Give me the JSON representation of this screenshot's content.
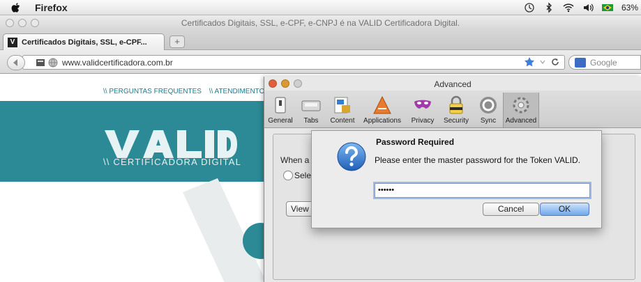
{
  "menubar": {
    "app_name": "Firefox",
    "battery_percent": "63%"
  },
  "browser": {
    "window_title": "Certificados Digitais, SSL, e-CPF, e-CNPJ é na VALID Certificadora Digital.",
    "tab_title": "Certificados Digitais, SSL, e-CPF...",
    "new_tab_symbol": "+",
    "url": "www.validcertificadora.com.br",
    "search_placeholder": "Google"
  },
  "page": {
    "topnav_links": [
      "\\\\ PERGUNTAS FREQUENTES",
      "\\\\ ATENDIMENTO"
    ],
    "brand_name": "VALID",
    "brand_subtitle": "\\\\ CERTIFICADORA DIGITAL",
    "accent_color": "#2b8a96"
  },
  "preferences": {
    "title": "Advanced",
    "tabs": [
      {
        "label": "General",
        "icon": "switch-icon"
      },
      {
        "label": "Tabs",
        "icon": "tabs-icon"
      },
      {
        "label": "Content",
        "icon": "content-icon"
      },
      {
        "label": "Applications",
        "icon": "applications-icon"
      },
      {
        "label": "Privacy",
        "icon": "mask-icon"
      },
      {
        "label": "Security",
        "icon": "padlock-icon"
      },
      {
        "label": "Sync",
        "icon": "sync-icon"
      },
      {
        "label": "Advanced",
        "icon": "gear-icon"
      }
    ],
    "selected_tab": "Advanced",
    "when_text": "When a",
    "select_text": "Sele",
    "view_button": "View"
  },
  "dialog": {
    "title": "Password Required",
    "message": "Please enter the master password for the Token VALID.",
    "password_value": "••••••",
    "cancel_label": "Cancel",
    "ok_label": "OK"
  }
}
